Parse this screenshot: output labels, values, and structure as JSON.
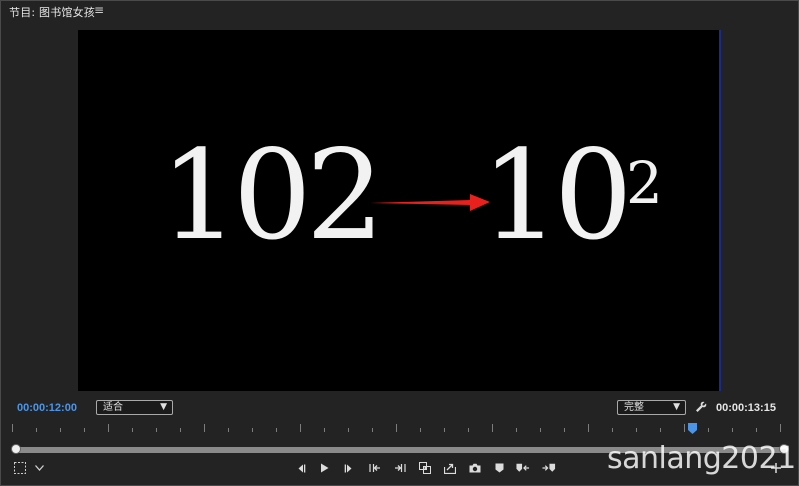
{
  "panel": {
    "title": "节目: 图书馆女孩",
    "menu_icon": "hamburger-menu-icon"
  },
  "monitor": {
    "expression_left": "102",
    "expression_right_base": "10",
    "expression_right_exponent": "2",
    "arrow_color": "#e8211c"
  },
  "timecodes": {
    "current": "00:00:12:00",
    "duration": "00:00:13:15"
  },
  "zoom_select": {
    "value": "适合"
  },
  "quality_select": {
    "value": "完整"
  },
  "timeline": {
    "playhead_color": "#4b95e8"
  },
  "controls": {
    "icons": [
      "mark-in-icon",
      "play-icon",
      "mark-out-icon",
      "go-to-in-icon",
      "go-to-out-icon",
      "insert-icon",
      "export-frame-out-icon",
      "camera-icon",
      "add-marker-icon",
      "go-to-previous-marker-icon",
      "go-to-next-marker-icon"
    ]
  },
  "watermark": {
    "text": "sanlang2021"
  },
  "colors": {
    "accent_timecode": "#4b95e8",
    "background": "#232323",
    "monitor": "#000000"
  }
}
